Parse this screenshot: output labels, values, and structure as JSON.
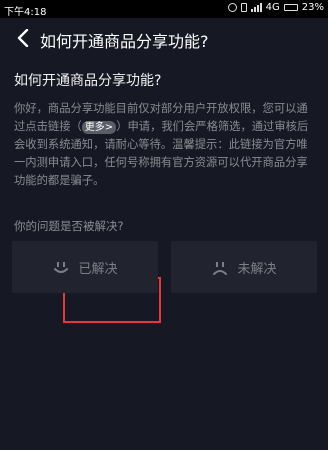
{
  "statusbar": {
    "time": "下午4:18",
    "network": "4G",
    "battery": "23%"
  },
  "navbar": {
    "title": "如何开通商品分享功能?"
  },
  "question": {
    "title": "如何开通商品分享功能?",
    "body_part1": "你好，商品分享功能目前仅对部分用户开放权限，您可以通过点击链接（",
    "more_label": "更多>",
    "body_part2": "）申请，我们会严格筛选，通过审核后会收到系统通知，请耐心等待。温馨提示：此链接为官方唯一内测申请入口，任何号称拥有官方资源可以代开商品分享功能的都是骗子。"
  },
  "feedback": {
    "prompt": "你的问题是否被解决?",
    "solved_label": "已解决",
    "unsolved_label": "未解决"
  },
  "colors": {
    "background": "#161823",
    "highlight": "#e53935",
    "button_bg": "#21232e"
  }
}
